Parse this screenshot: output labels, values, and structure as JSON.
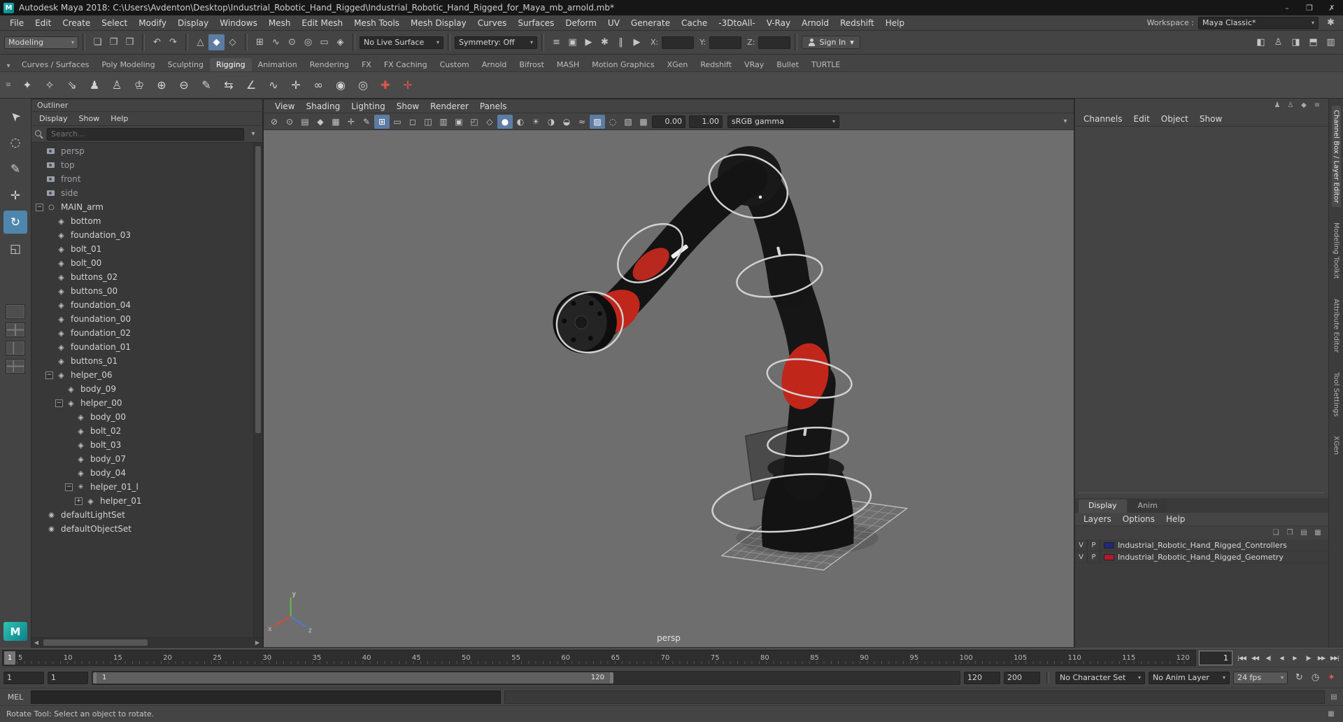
{
  "window": {
    "title": "Autodesk Maya 2018: C:\\Users\\Avdenton\\Desktop\\Industrial_Robotic_Hand_Rigged\\Industrial_Robotic_Hand_Rigged_for_Maya_mb_arnold.mb*"
  },
  "menu_bar": {
    "items": [
      "File",
      "Edit",
      "Create",
      "Select",
      "Modify",
      "Display",
      "Windows",
      "Mesh",
      "Edit Mesh",
      "Mesh Tools",
      "Mesh Display",
      "Curves",
      "Surfaces",
      "Deform",
      "UV",
      "Generate",
      "Cache",
      "-3DtoAll-",
      "V-Ray",
      "Arnold",
      "Redshift",
      "Help"
    ],
    "workspace_label": "Workspace :",
    "workspace_value": "Maya Classic*"
  },
  "status_line": {
    "mode_selector": "Modeling",
    "icon_groups": [
      [
        "new-scene-icon",
        "open-scene-icon",
        "save-scene-icon"
      ],
      [
        "undo-icon",
        "redo-icon"
      ],
      [
        "select-hierarchy-icon",
        "select-object-icon",
        "select-component-icon"
      ],
      [
        "snap-grid-icon",
        "snap-curve-icon",
        "snap-point-icon",
        "snap-projected-center-icon",
        "snap-view-plane-icon",
        "make-live-icon"
      ],
      [
        "construction-history-icon",
        "render-icon",
        "ipr-render-icon",
        "render-settings-icon",
        "pause-icon",
        "playback-icon"
      ]
    ],
    "live_surface": "No Live Surface",
    "symmetry": "Symmetry: Off",
    "coords": [
      {
        "label": "X:",
        "value": ""
      },
      {
        "label": "Y:",
        "value": ""
      },
      {
        "label": "Z:",
        "value": ""
      }
    ],
    "sign_in_label": "Sign In",
    "right_icons": [
      "modeling-toolkit-toggle-icon",
      "humanik-toggle-icon",
      "attribute-editor-toggle-icon",
      "tool-settings-toggle-icon",
      "channel-box-toggle-icon"
    ]
  },
  "shelf": {
    "tabs": [
      "Curves / Surfaces",
      "Poly Modeling",
      "Sculpting",
      "Rigging",
      "Animation",
      "Rendering",
      "FX",
      "FX Caching",
      "Custom",
      "Arnold",
      "Bifrost",
      "MASH",
      "Motion Graphics",
      "XGen",
      "Redshift",
      "VRay",
      "Bullet",
      "TURTLE"
    ],
    "active_tab": "Rigging",
    "icons": [
      "create-joint-icon",
      "insert-joint-icon",
      "ik-handle-icon",
      "skeleton-icon",
      "quick-rig-icon",
      "humanik-icon",
      "bind-skin-icon",
      "unbind-skin-icon",
      "paint-skin-weights-icon",
      "mirror-skin-weights-icon",
      "ik-fk-blend-icon",
      "spline-ik-icon",
      "pole-vector-icon",
      "parent-constraint-icon",
      "point-constraint-icon",
      "aim-constraint-icon",
      "create-control-icon",
      "mirror-control-icon"
    ]
  },
  "toolbox": {
    "tools": [
      {
        "name": "select-tool",
        "active": false
      },
      {
        "name": "lasso-tool",
        "active": false
      },
      {
        "name": "paint-select-tool",
        "active": false
      },
      {
        "name": "move-tool",
        "active": false
      },
      {
        "name": "rotate-tool",
        "active": true
      },
      {
        "name": "scale-tool",
        "active": false
      }
    ],
    "layouts": [
      "single-pane-layout",
      "four-pane-layout",
      "two-pane-layout",
      "three-pane-layout"
    ]
  },
  "outliner": {
    "panel_title": "Outliner",
    "menus": [
      "Display",
      "Show",
      "Help"
    ],
    "search_placeholder": "Search...",
    "tree": [
      {
        "label": "persp",
        "icon": "camera-icon",
        "level": 0,
        "toggle": "",
        "dim": true
      },
      {
        "label": "top",
        "icon": "camera-icon",
        "level": 0,
        "toggle": "",
        "dim": true
      },
      {
        "label": "front",
        "icon": "camera-icon",
        "level": 0,
        "toggle": "",
        "dim": true
      },
      {
        "label": "side",
        "icon": "camera-icon",
        "level": 0,
        "toggle": "",
        "dim": true
      },
      {
        "label": "MAIN_arm",
        "icon": "group-icon",
        "level": 0,
        "toggle": "minus",
        "dim": false
      },
      {
        "label": "bottom",
        "icon": "mesh-icon",
        "level": 1,
        "toggle": "",
        "dim": false
      },
      {
        "label": "foundation_03",
        "icon": "mesh-icon",
        "level": 1,
        "toggle": "",
        "dim": false
      },
      {
        "label": "bolt_01",
        "icon": "mesh-icon",
        "level": 1,
        "toggle": "",
        "dim": false
      },
      {
        "label": "bolt_00",
        "icon": "mesh-icon",
        "level": 1,
        "toggle": "",
        "dim": false
      },
      {
        "label": "buttons_02",
        "icon": "mesh-icon",
        "level": 1,
        "toggle": "",
        "dim": false
      },
      {
        "label": "buttons_00",
        "icon": "mesh-icon",
        "level": 1,
        "toggle": "",
        "dim": false
      },
      {
        "label": "foundation_04",
        "icon": "mesh-icon",
        "level": 1,
        "toggle": "",
        "dim": false
      },
      {
        "label": "foundation_00",
        "icon": "mesh-icon",
        "level": 1,
        "toggle": "",
        "dim": false
      },
      {
        "label": "foundation_02",
        "icon": "mesh-icon",
        "level": 1,
        "toggle": "",
        "dim": false
      },
      {
        "label": "foundation_01",
        "icon": "mesh-icon",
        "level": 1,
        "toggle": "",
        "dim": false
      },
      {
        "label": "buttons_01",
        "icon": "mesh-icon",
        "level": 1,
        "toggle": "",
        "dim": false
      },
      {
        "label": "helper_06",
        "icon": "mesh-icon",
        "level": 1,
        "toggle": "minus",
        "dim": false
      },
      {
        "label": "body_09",
        "icon": "mesh-icon",
        "level": 2,
        "toggle": "",
        "dim": false
      },
      {
        "label": "helper_00",
        "icon": "mesh-icon",
        "level": 2,
        "toggle": "minus",
        "dim": false
      },
      {
        "label": "body_00",
        "icon": "mesh-icon",
        "level": 3,
        "toggle": "",
        "dim": false
      },
      {
        "label": "bolt_02",
        "icon": "mesh-icon",
        "level": 3,
        "toggle": "",
        "dim": false
      },
      {
        "label": "bolt_03",
        "icon": "mesh-icon",
        "level": 3,
        "toggle": "",
        "dim": false
      },
      {
        "label": "body_07",
        "icon": "mesh-icon",
        "level": 3,
        "toggle": "",
        "dim": false
      },
      {
        "label": "body_04",
        "icon": "mesh-icon",
        "level": 3,
        "toggle": "",
        "dim": false
      },
      {
        "label": "helper_01_l",
        "icon": "ik-icon",
        "level": 3,
        "toggle": "minus",
        "dim": false
      },
      {
        "label": "helper_01",
        "icon": "mesh-icon",
        "level": 4,
        "toggle": "plus",
        "dim": false
      },
      {
        "label": "defaultLightSet",
        "icon": "set-icon",
        "level": 0,
        "toggle": "",
        "dim": false
      },
      {
        "label": "defaultObjectSet",
        "icon": "set-icon",
        "level": 0,
        "toggle": "",
        "dim": false
      }
    ]
  },
  "viewport": {
    "menus": [
      "View",
      "Shading",
      "Lighting",
      "Show",
      "Renderer",
      "Panels"
    ],
    "toolbar_icons": [
      "select-camera-icon",
      "lock-camera-icon",
      "camera-attributes-icon",
      "bookmarks-icon",
      "image-plane-icon",
      "pan-zoom-icon",
      "grease-pencil-icon",
      "grid-icon",
      "film-gate-icon",
      "resolution-gate-icon",
      "gate-mask-icon",
      "field-chart-icon",
      "safe-action-icon",
      "safe-title-icon",
      "wireframe-icon",
      "shaded-icon",
      "textured-icon",
      "lights-icon",
      "shadows-icon",
      "ao-icon",
      "motion-blur-icon",
      "aa-icon",
      "dof-icon",
      "isolate-select-icon",
      "xray-icon"
    ],
    "exposure": "0.00",
    "gamma": "1.00",
    "color_space": "sRGB gamma",
    "camera_label": "persp"
  },
  "channel_box": {
    "menus": [
      "Channels",
      "Edit",
      "Object",
      "Show"
    ],
    "corner_icons": [
      "character-icon",
      "character-outline-icon",
      "pin-icon",
      "panel-menu-icon"
    ]
  },
  "layer_editor": {
    "tabs": [
      {
        "label": "Display",
        "active": true
      },
      {
        "label": "Anim",
        "active": false
      }
    ],
    "menus": [
      "Layers",
      "Options",
      "Help"
    ],
    "toolbar_icons": [
      "layer-sort-icon",
      "layer-new-icon",
      "layer-new-selected-icon",
      "layer-options-icon"
    ],
    "layers": [
      {
        "visible": "V",
        "playback": "P",
        "color": "#20287d",
        "name": "Industrial_Robotic_Hand_Rigged_Controllers"
      },
      {
        "visible": "V",
        "playback": "P",
        "color": "#b01a31",
        "name": "Industrial_Robotic_Hand_Rigged_Geometry"
      }
    ]
  },
  "sidebar_tabs": [
    {
      "label": "Channel Box / Layer Editor",
      "active": true
    },
    {
      "label": "Modeling Toolkit",
      "active": false
    },
    {
      "label": "Attribute Editor",
      "active": false
    },
    {
      "label": "Tool Settings",
      "active": false
    },
    {
      "label": "XGen",
      "active": false
    }
  ],
  "time_slider": {
    "ticks": [
      "5",
      "10",
      "15",
      "20",
      "25",
      "30",
      "35",
      "40",
      "45",
      "50",
      "55",
      "60",
      "65",
      "70",
      "75",
      "80",
      "85",
      "90",
      "95",
      "100",
      "105",
      "110",
      "115",
      "120"
    ],
    "current_frame": "1",
    "playback_buttons": [
      "go-to-start",
      "step-back-frame",
      "step-back-key",
      "play-backwards",
      "play-forwards",
      "step-forward-key",
      "step-forward-frame",
      "go-to-end"
    ]
  },
  "range_slider": {
    "animation_start": "1",
    "playback_start": "1",
    "handle_start_label": "1",
    "handle_end_label": "120",
    "playback_end": "120",
    "animation_end": "200",
    "character_set": "No Character Set",
    "anim_layer": "No Anim Layer",
    "fps": "24 fps",
    "icons": [
      "playback-loop-icon",
      "anim-preferences-icon",
      "auto-keyframe-icon"
    ]
  },
  "command_line": {
    "label": "MEL"
  },
  "help_line": {
    "text": "Rotate Tool: Select an object to rotate."
  }
}
